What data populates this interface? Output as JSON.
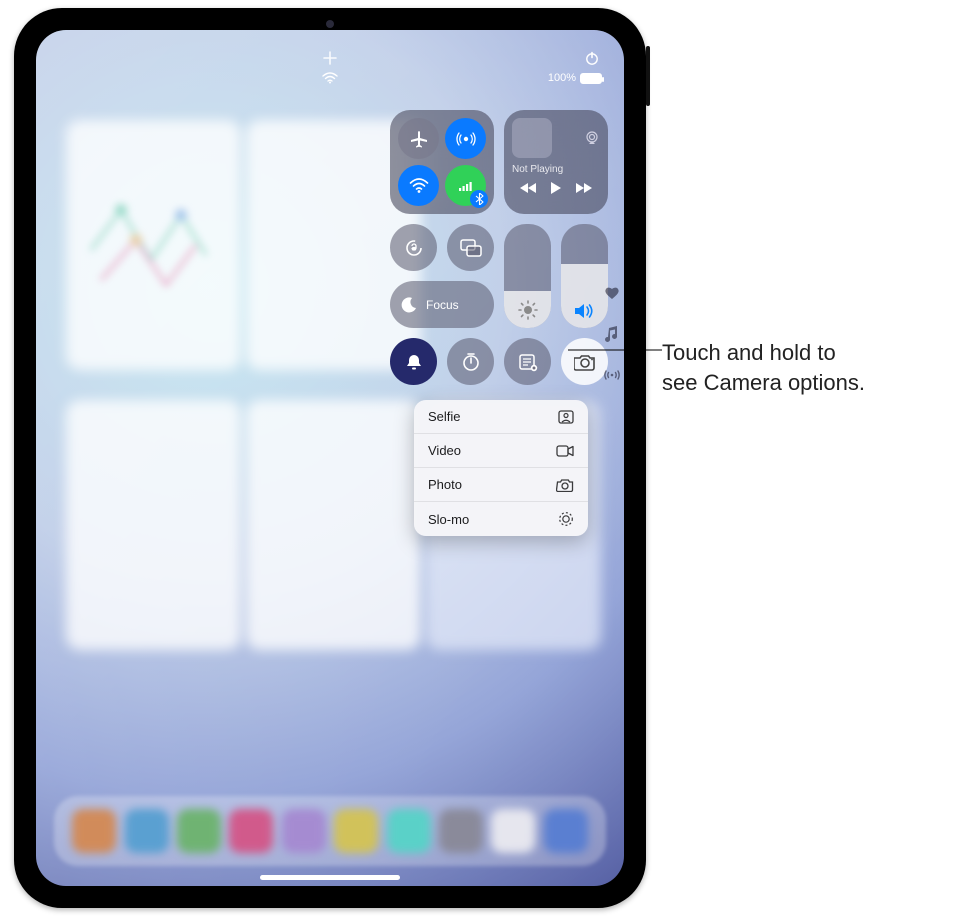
{
  "status": {
    "battery_text": "100%"
  },
  "media": {
    "not_playing": "Not Playing"
  },
  "focus": {
    "label": "Focus"
  },
  "camera_menu": {
    "items": [
      {
        "label": "Selfie"
      },
      {
        "label": "Video"
      },
      {
        "label": "Photo"
      },
      {
        "label": "Slo-mo"
      }
    ]
  },
  "sliders": {
    "brightness_pct": 36,
    "volume_pct": 62
  },
  "callout": {
    "line1": "Touch and hold to",
    "line2": "see Camera options."
  },
  "colors": {
    "ios_blue": "#0a7aff",
    "ios_green": "#30d158"
  }
}
